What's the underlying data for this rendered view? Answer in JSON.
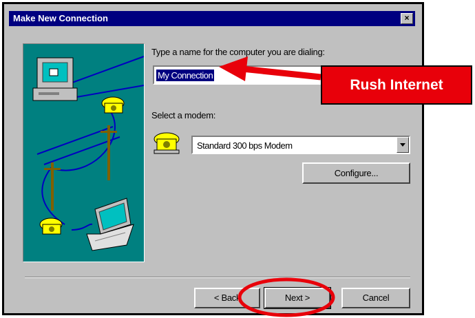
{
  "window": {
    "title": "Make New Connection",
    "close_symbol": "×"
  },
  "form": {
    "name_label": "Type a name for the computer you are dialing:",
    "name_value": "My Connection",
    "modem_label": "Select a modem:",
    "modem_value": "Standard   300 bps Modem"
  },
  "buttons": {
    "configure": "Configure...",
    "back": "< Back",
    "next": "Next >",
    "cancel": "Cancel"
  },
  "annotation": {
    "callout_text": "Rush Internet",
    "accent_color": "#e8000a"
  }
}
